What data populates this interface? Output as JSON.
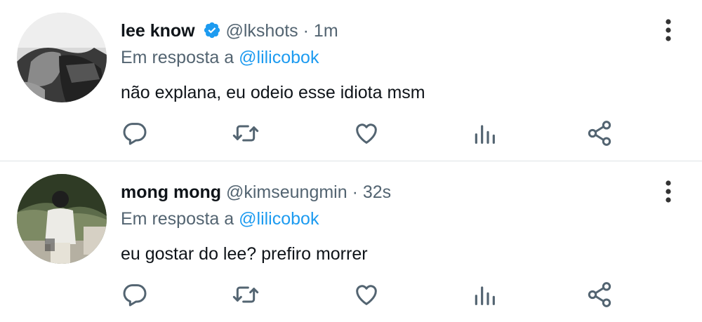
{
  "tweets": [
    {
      "display_name": "lee know",
      "verified": true,
      "handle": "@lkshots",
      "separator": "·",
      "time": "1m",
      "reply_prefix": "Em resposta a",
      "reply_to": "@lilicobok",
      "text": "não explana, eu odeio esse idiota msm",
      "actions": [
        "reply-icon",
        "retweet-icon",
        "like-icon",
        "views-icon",
        "share-icon"
      ]
    },
    {
      "display_name": "mong mong",
      "verified": false,
      "handle": "@kimseungmin",
      "separator": "·",
      "time": "32s",
      "reply_prefix": "Em resposta a",
      "reply_to": "@lilicobok",
      "text": "eu gostar do lee? prefiro morrer",
      "actions": [
        "reply-icon",
        "retweet-icon",
        "like-icon",
        "views-icon",
        "share-icon"
      ]
    }
  ],
  "colors": {
    "text": "#0f1419",
    "secondary": "#536471",
    "link": "#1d9bf0",
    "verified": "#1d9bf0",
    "divider": "#dfe3e6"
  }
}
